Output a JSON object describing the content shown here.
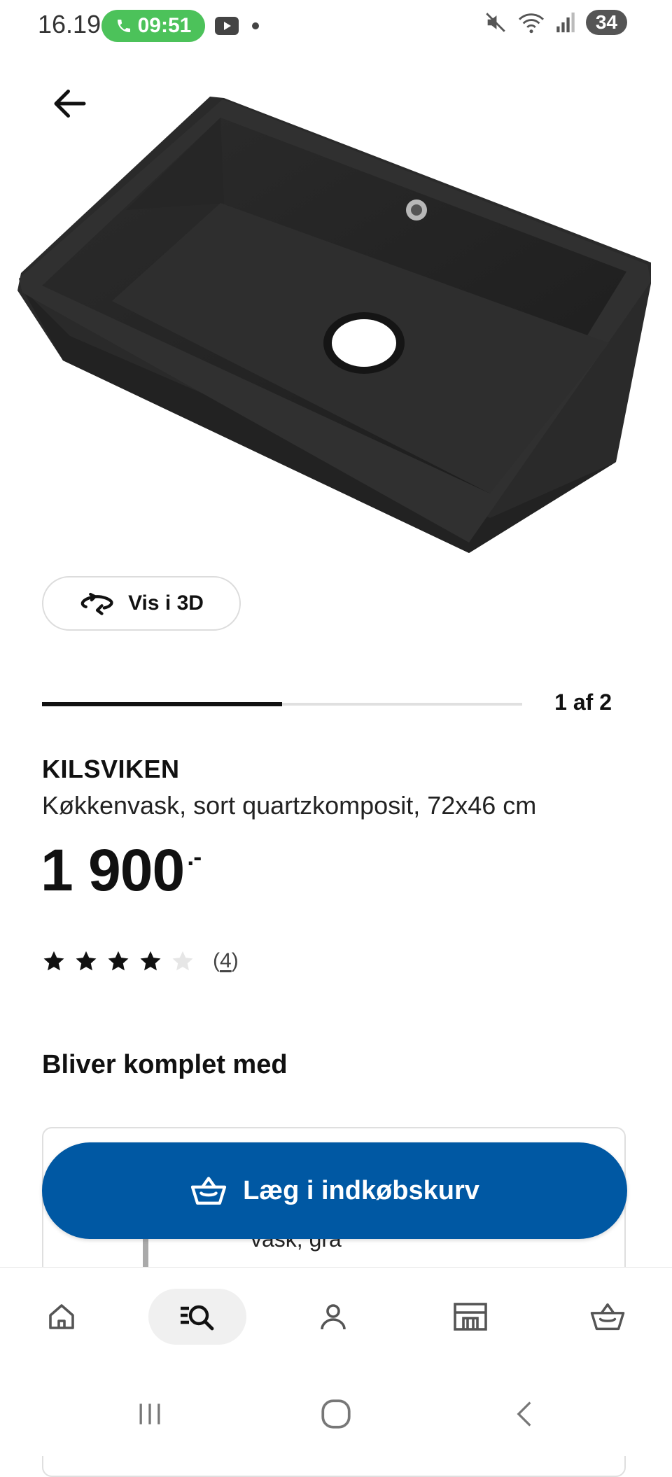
{
  "status_bar": {
    "time": "16.19",
    "call_timer": "09:51",
    "battery": "34"
  },
  "gallery": {
    "view_3d_label": "Vis i 3D",
    "pager_text": "1 af 2",
    "progress": 0.5
  },
  "product": {
    "brand": "KILSVIKEN",
    "description": "Køkkenvask, sort quartzkomposit, 72x46 cm",
    "price": "1 900",
    "price_suffix": ".-",
    "rating": 4,
    "rating_max": 5,
    "review_count": "4"
  },
  "complete_with": {
    "title": "Bliver komplet med",
    "card_text": "vask, grå"
  },
  "cta": {
    "label": "Læg i indkøbskurv"
  },
  "bottom_nav": {
    "items": [
      "home-icon",
      "search-list-icon",
      "profile-icon",
      "store-icon",
      "basket-icon"
    ],
    "active": "search-list-icon"
  },
  "colors": {
    "accent": "#0058a3",
    "call_green": "#4cc25a"
  }
}
